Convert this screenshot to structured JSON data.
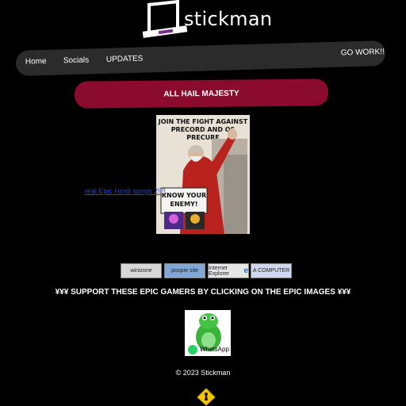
{
  "brand": {
    "name": "stickman"
  },
  "nav": {
    "items": [
      {
        "label": "Home"
      },
      {
        "label": "Socials"
      },
      {
        "label": "UPDATES"
      }
    ],
    "right_label": "GO WORK!!"
  },
  "banner": {
    "label": "ALL HAIL MAJESTY"
  },
  "poster": {
    "title_line1": "JOIN THE FIGHT AGAINST",
    "title_line2": "PRECORD AND OS PRECURE",
    "sign_line1": "KNOW YOUR",
    "sign_line2": "ENEMY!",
    "caption": "real Epic Hindi songs 2!!!!"
  },
  "badges": [
    {
      "label": "winizone",
      "color": "#d8d8d8"
    },
    {
      "label": "poopie site",
      "color": "#7fa8d8"
    },
    {
      "label": "Internet Explorer",
      "color": "#e6e6e6"
    },
    {
      "label": "A COMPUTER",
      "color": "#cfd8f0"
    }
  ],
  "support": {
    "text": "¥¥¥ SUPPORT THESE EPIC GAMERS BY CLICKING ON THE EPIC IMAGES ¥¥¥"
  },
  "whatsapp": {
    "label": "WhatsApp"
  },
  "footer": {
    "copyright": "© 2023 Stickman"
  },
  "colors": {
    "background": "#000000",
    "navbar": "#2b2b2b",
    "banner": "#8b0b2e",
    "link": "#2447d8",
    "logo_accent": "#7b2d8e"
  }
}
